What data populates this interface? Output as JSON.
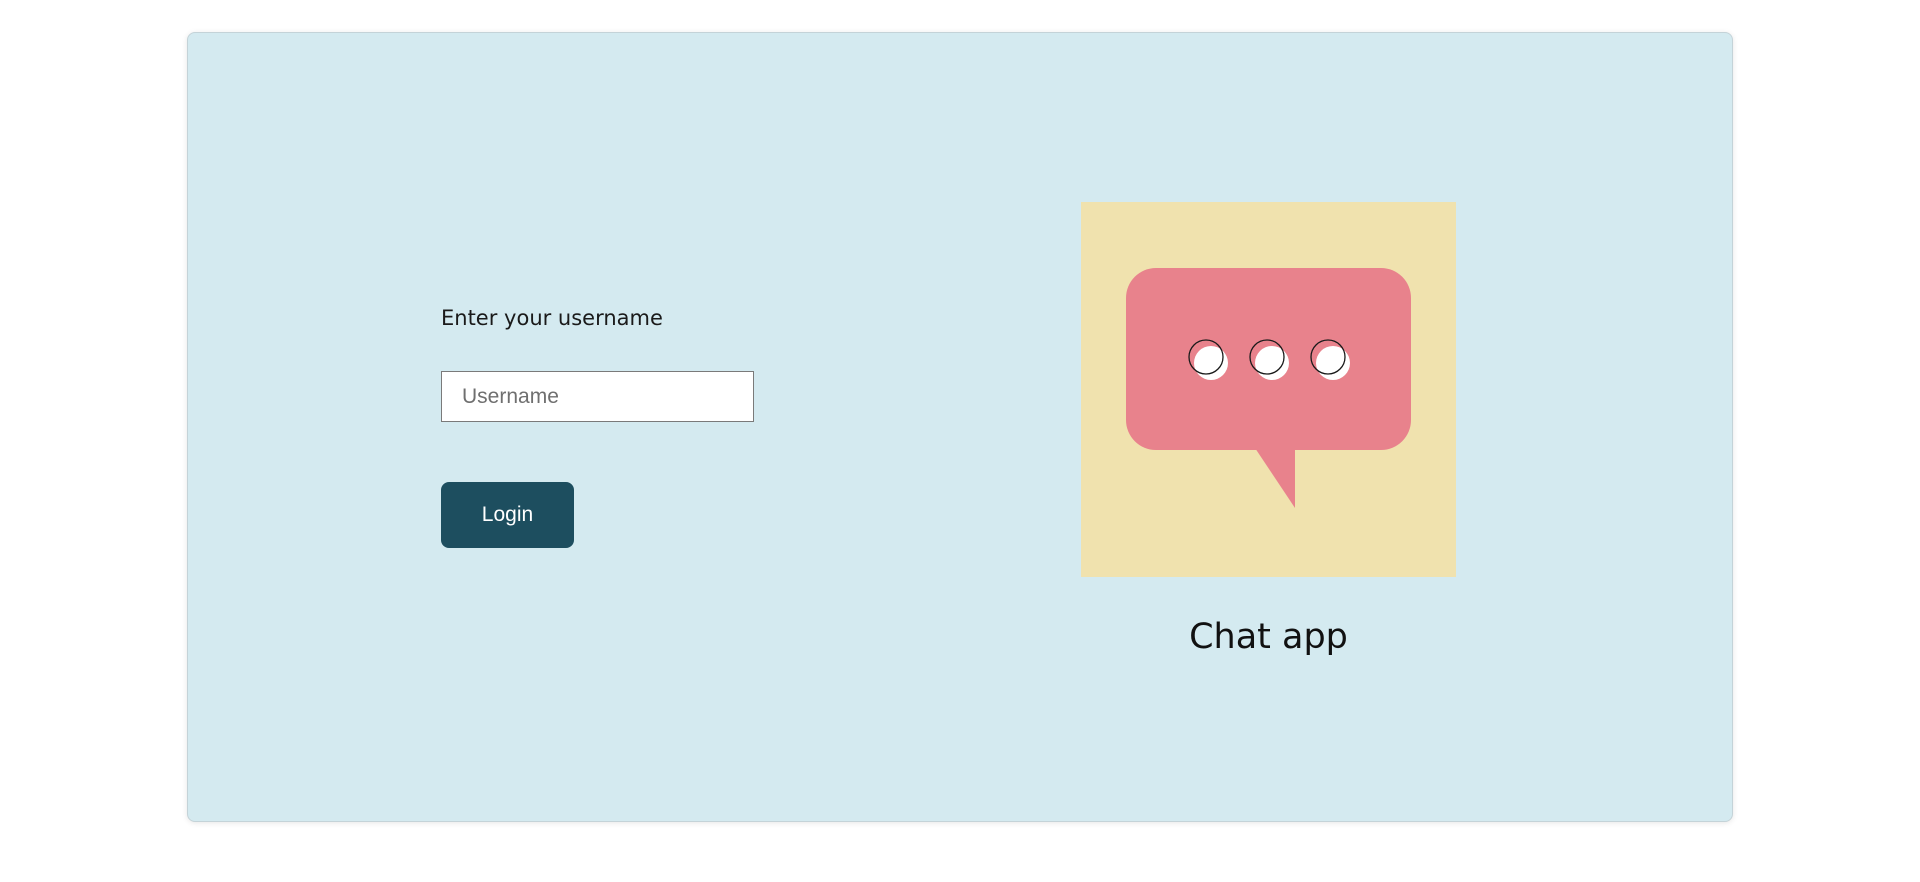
{
  "login": {
    "label": "Enter your username",
    "username_placeholder": "Username",
    "username_value": "",
    "button_label": "Login"
  },
  "brand": {
    "title": "Chat app",
    "illustration_icon": "chat-bubble-icon",
    "colors": {
      "illustration_background": "#f0e2ae",
      "bubble": "#e8828c",
      "dots": "#ffffff"
    }
  },
  "colors": {
    "page_background": "#ffffff",
    "card_background": "#d4eaf0",
    "button_background": "#1d4e5f",
    "button_text": "#ffffff"
  }
}
